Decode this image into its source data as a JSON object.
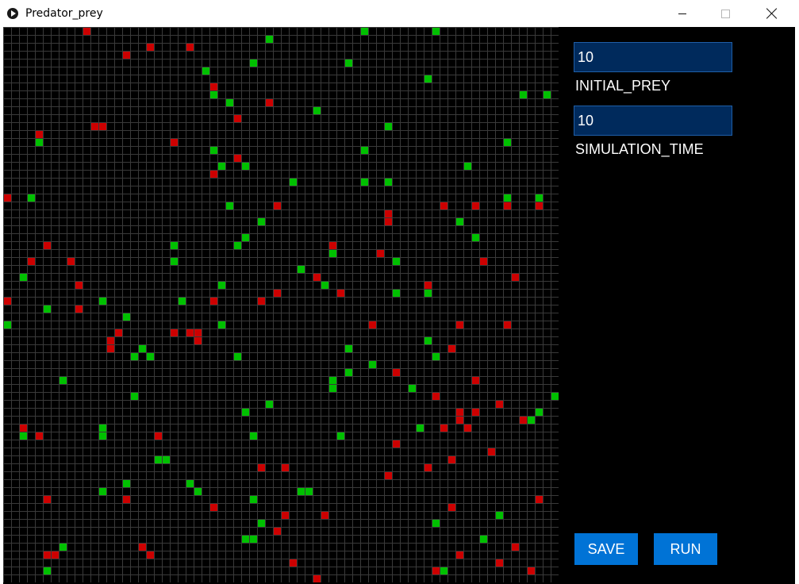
{
  "window": {
    "title": "Predator_prey"
  },
  "colors": {
    "predator": "#cc0000",
    "prey": "#00c000",
    "grid_line": "#3a3a3a",
    "background": "#000000",
    "button": "#0073d6",
    "input_bg": "#002a5c"
  },
  "controls": {
    "initial_prey": {
      "value": "10",
      "label": "INITIAL_PREY"
    },
    "simulation_time": {
      "value": "10",
      "label": "SIMULATION_TIME"
    },
    "save_label": "SAVE",
    "run_label": "RUN"
  },
  "grid": {
    "cols": 70,
    "rows": 70,
    "predators": [
      [
        10,
        0
      ],
      [
        15,
        3
      ],
      [
        18,
        2
      ],
      [
        23,
        2
      ],
      [
        26,
        7
      ],
      [
        33,
        9
      ],
      [
        29,
        11
      ],
      [
        11,
        12
      ],
      [
        12,
        12
      ],
      [
        4,
        13
      ],
      [
        21,
        14
      ],
      [
        29,
        16
      ],
      [
        26,
        18
      ],
      [
        0,
        21
      ],
      [
        34,
        22
      ],
      [
        48,
        23
      ],
      [
        55,
        22
      ],
      [
        59,
        22
      ],
      [
        63,
        22
      ],
      [
        67,
        22
      ],
      [
        48,
        24
      ],
      [
        5,
        27
      ],
      [
        41,
        27
      ],
      [
        47,
        28
      ],
      [
        3,
        29
      ],
      [
        8,
        29
      ],
      [
        60,
        29
      ],
      [
        39,
        31
      ],
      [
        64,
        31
      ],
      [
        9,
        32
      ],
      [
        53,
        32
      ],
      [
        34,
        33
      ],
      [
        42,
        33
      ],
      [
        0,
        34
      ],
      [
        9,
        35
      ],
      [
        26,
        34
      ],
      [
        32,
        34
      ],
      [
        14,
        38
      ],
      [
        21,
        38
      ],
      [
        23,
        38
      ],
      [
        24,
        38
      ],
      [
        46,
        37
      ],
      [
        57,
        37
      ],
      [
        63,
        37
      ],
      [
        13,
        39
      ],
      [
        24,
        39
      ],
      [
        13,
        40
      ],
      [
        56,
        40
      ],
      [
        49,
        43
      ],
      [
        59,
        44
      ],
      [
        54,
        46
      ],
      [
        62,
        47
      ],
      [
        57,
        48
      ],
      [
        59,
        48
      ],
      [
        65,
        49
      ],
      [
        57,
        49
      ],
      [
        55,
        50
      ],
      [
        58,
        50
      ],
      [
        2,
        50
      ],
      [
        4,
        51
      ],
      [
        19,
        51
      ],
      [
        49,
        52
      ],
      [
        61,
        53
      ],
      [
        56,
        54
      ],
      [
        32,
        55
      ],
      [
        35,
        55
      ],
      [
        48,
        56
      ],
      [
        53,
        55
      ],
      [
        5,
        59
      ],
      [
        15,
        59
      ],
      [
        56,
        60
      ],
      [
        67,
        59
      ],
      [
        26,
        60
      ],
      [
        35,
        61
      ],
      [
        40,
        61
      ],
      [
        34,
        63
      ],
      [
        17,
        65
      ],
      [
        64,
        65
      ],
      [
        5,
        66
      ],
      [
        6,
        66
      ],
      [
        18,
        66
      ],
      [
        57,
        66
      ],
      [
        36,
        67
      ],
      [
        62,
        67
      ],
      [
        54,
        68
      ],
      [
        66,
        68
      ],
      [
        39,
        69
      ]
    ],
    "prey": [
      [
        33,
        1
      ],
      [
        45,
        0
      ],
      [
        54,
        0
      ],
      [
        31,
        4
      ],
      [
        43,
        4
      ],
      [
        25,
        5
      ],
      [
        53,
        6
      ],
      [
        26,
        8
      ],
      [
        28,
        9
      ],
      [
        65,
        8
      ],
      [
        68,
        8
      ],
      [
        39,
        10
      ],
      [
        48,
        12
      ],
      [
        4,
        14
      ],
      [
        26,
        15
      ],
      [
        45,
        15
      ],
      [
        63,
        14
      ],
      [
        27,
        17
      ],
      [
        30,
        17
      ],
      [
        58,
        17
      ],
      [
        36,
        19
      ],
      [
        45,
        19
      ],
      [
        48,
        19
      ],
      [
        3,
        21
      ],
      [
        63,
        21
      ],
      [
        67,
        21
      ],
      [
        28,
        22
      ],
      [
        32,
        24
      ],
      [
        57,
        24
      ],
      [
        30,
        26
      ],
      [
        59,
        26
      ],
      [
        21,
        27
      ],
      [
        29,
        27
      ],
      [
        41,
        28
      ],
      [
        49,
        29
      ],
      [
        21,
        29
      ],
      [
        37,
        30
      ],
      [
        2,
        31
      ],
      [
        27,
        32
      ],
      [
        40,
        32
      ],
      [
        49,
        33
      ],
      [
        53,
        33
      ],
      [
        12,
        34
      ],
      [
        22,
        34
      ],
      [
        5,
        35
      ],
      [
        15,
        36
      ],
      [
        0,
        37
      ],
      [
        27,
        37
      ],
      [
        53,
        39
      ],
      [
        17,
        40
      ],
      [
        43,
        40
      ],
      [
        16,
        41
      ],
      [
        18,
        41
      ],
      [
        29,
        41
      ],
      [
        54,
        41
      ],
      [
        46,
        42
      ],
      [
        43,
        43
      ],
      [
        7,
        44
      ],
      [
        41,
        44
      ],
      [
        41,
        45
      ],
      [
        51,
        45
      ],
      [
        16,
        46
      ],
      [
        69,
        46
      ],
      [
        33,
        47
      ],
      [
        30,
        48
      ],
      [
        67,
        48
      ],
      [
        52,
        50
      ],
      [
        66,
        49
      ],
      [
        12,
        50
      ],
      [
        2,
        51
      ],
      [
        12,
        51
      ],
      [
        31,
        51
      ],
      [
        42,
        51
      ],
      [
        19,
        54
      ],
      [
        20,
        54
      ],
      [
        15,
        57
      ],
      [
        23,
        57
      ],
      [
        12,
        58
      ],
      [
        24,
        58
      ],
      [
        37,
        58
      ],
      [
        38,
        58
      ],
      [
        31,
        59
      ],
      [
        62,
        61
      ],
      [
        32,
        62
      ],
      [
        54,
        62
      ],
      [
        30,
        64
      ],
      [
        31,
        64
      ],
      [
        60,
        64
      ],
      [
        7,
        65
      ],
      [
        5,
        68
      ],
      [
        55,
        68
      ]
    ]
  }
}
